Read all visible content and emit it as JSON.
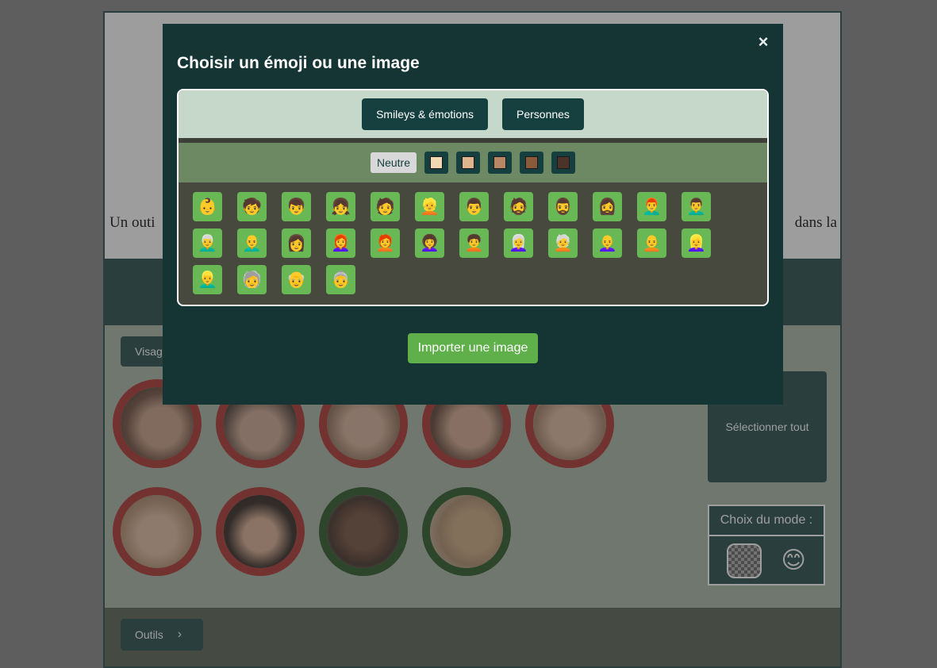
{
  "page": {
    "text_left": "Un outi",
    "text_right": "dans la",
    "visage_button": "Visag",
    "outils_button": "Outils",
    "select_all": "Sélectionner tout",
    "mode_title": "Choix du mode :",
    "mode_emoji": "😊"
  },
  "modal": {
    "title": "Choisir un émoji ou une image",
    "close": "×",
    "categories": [
      "Smileys & émotions",
      "Personnes"
    ],
    "tone_neutral": "Neutre",
    "tone_colors": [
      "#f3d8b4",
      "#e0b48e",
      "#b98763",
      "#8a5a3b",
      "#4b3427"
    ],
    "emojis": [
      "👶",
      "🧒",
      "👦",
      "👧",
      "🧑",
      "👱",
      "👨",
      "🧔",
      "🧔‍♂️",
      "🧔‍♀️",
      "👨‍🦰",
      "👨‍🦱",
      "👨‍🦳",
      "👨‍🦲",
      "👩",
      "👩‍🦰",
      "🧑‍🦰",
      "👩‍🦱",
      "🧑‍🦱",
      "👩‍🦳",
      "🧑‍🦳",
      "👩‍🦲",
      "🧑‍🦲",
      "👱‍♀️",
      "👱‍♂️",
      "🧓",
      "👴",
      "👵"
    ],
    "import_button": "Importer une image"
  },
  "colors": {
    "accent_teal": "#16403f",
    "accent_green": "#5fb04a",
    "ring_red": "#a92b24",
    "ring_green": "#1f4e1a"
  }
}
